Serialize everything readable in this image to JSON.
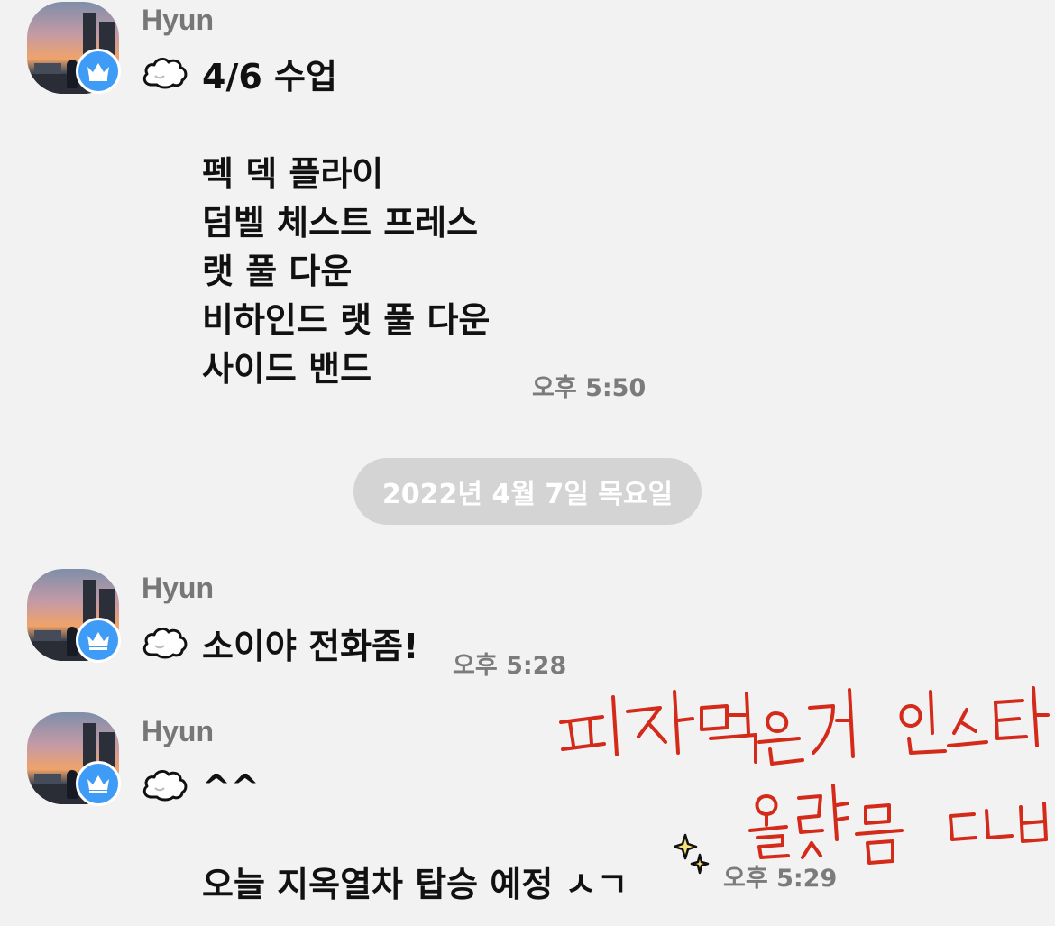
{
  "messages": [
    {
      "sender": "Hyun",
      "lines": "4/6 수업\n\n펙 덱 플라이\n덤벨 체스트 프레스\n랫 풀 다운\n비하인드 랫 풀 다운\n사이드 밴드",
      "time": "오후 5:50"
    },
    {
      "sender": "Hyun",
      "lines": "소이야 전화좀!",
      "time": "오후 5:28"
    },
    {
      "sender": "Hyun",
      "lines": "^^\n\n오늘 지옥열차 탑승 예정 ㅅㄱ",
      "time": "오후 5:29"
    }
  ],
  "date_divider": "2022년 4월 7일 목요일",
  "handwritten_note": "피자 먹은거 인스타 올렸음 ㄷㄴㅂ",
  "icons": {
    "badge": "crown-icon",
    "emoji_message": "cloud-icon",
    "emoji_sparkle": "sparkles-icon"
  },
  "colors": {
    "background": "#f2f2f2",
    "badge": "#3f9cf6",
    "date_pill": "#d4d4d4",
    "annotation": "#d42a1a"
  }
}
